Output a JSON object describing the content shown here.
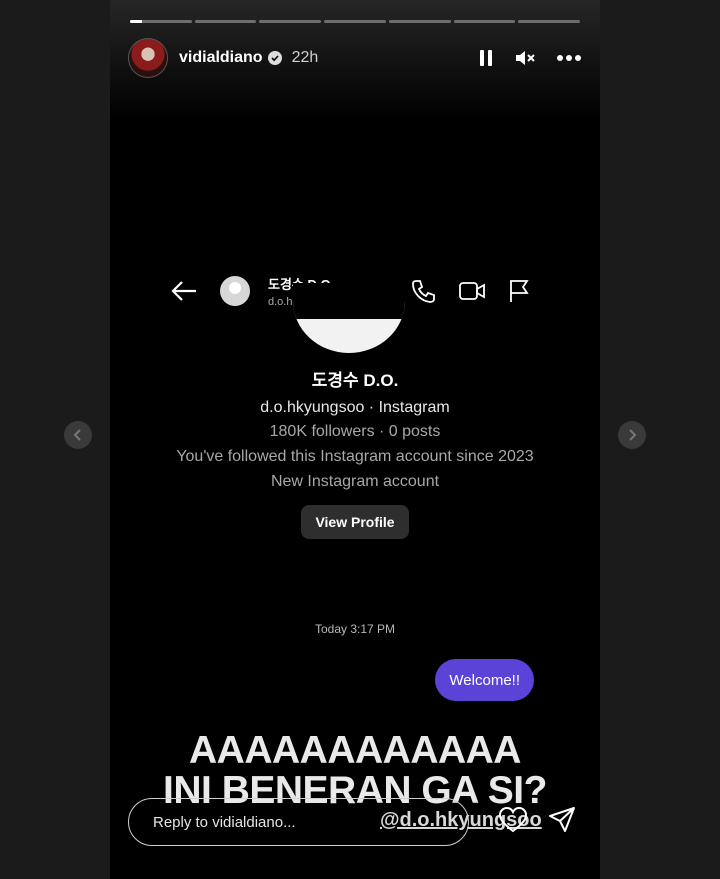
{
  "story": {
    "progress": {
      "segments": 7,
      "current_index": 0,
      "current_fill": 0.2
    },
    "header": {
      "username": "vidialdiano",
      "verified": true,
      "time": "22h",
      "actions": [
        "pause-icon",
        "mute-icon",
        "more-icon"
      ]
    },
    "content": {
      "dm": {
        "name": "도경수 D.O.",
        "handle": "d.o.hkyungsoo",
        "actions": [
          "phone-icon",
          "video-icon",
          "flag-icon"
        ]
      },
      "profile": {
        "name": "도경수 D.O.",
        "subtitle": "d.o.hkyungsoo · Instagram",
        "stats": "180K followers · 0 posts",
        "since": "You've followed this Instagram account since 2023",
        "note": "New Instagram account",
        "button": "View Profile"
      },
      "timestamp": "Today 3:17 PM",
      "message": "Welcome!!",
      "caption_line1": "AAAAAAAAAAAA",
      "caption_line2": "INI BENERAN GA SI?",
      "mention": "@d.o.hkyungsoo"
    },
    "reply": {
      "placeholder": "Reply to vidialdiano...",
      "actions": [
        "heart-icon",
        "send-icon"
      ]
    }
  },
  "nav": {
    "prev_icon": "chevron-left-icon",
    "next_icon": "chevron-right-icon"
  },
  "colors": {
    "bubble": "#5a43d6",
    "background": "#1b1b1b",
    "story_bg": "#000000"
  }
}
